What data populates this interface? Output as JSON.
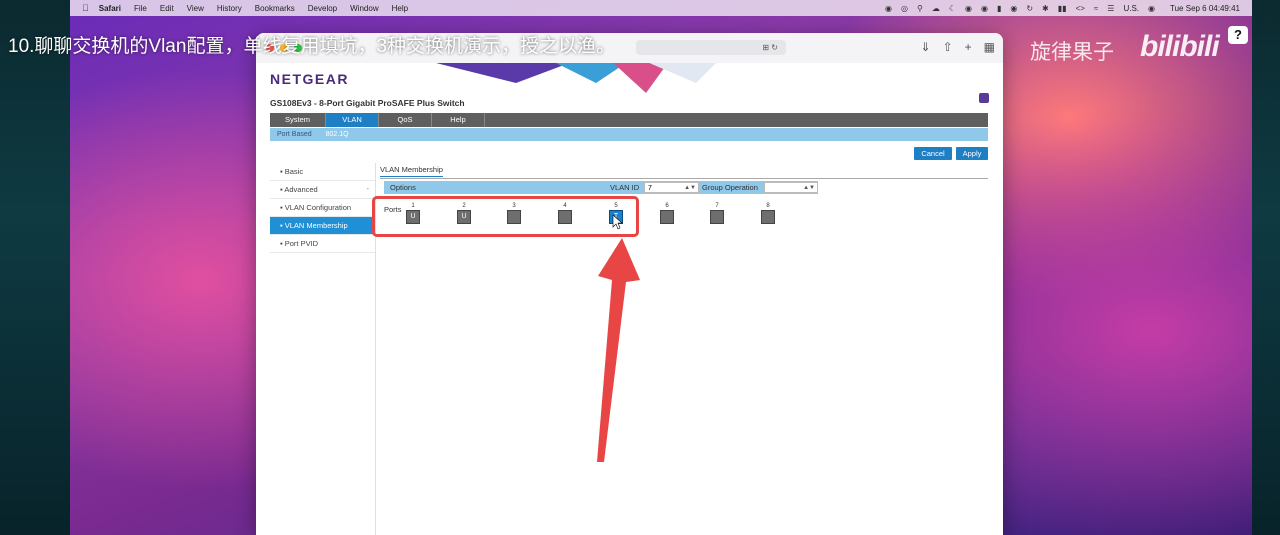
{
  "menubar": {
    "app": "Safari",
    "items": [
      "File",
      "Edit",
      "View",
      "History",
      "Bookmarks",
      "Develop",
      "Window",
      "Help"
    ],
    "input_source": "U.S.",
    "clock": "Tue Sep 6  04:49:41"
  },
  "overlay": {
    "caption": "10.聊聊交换机的Vlan配置，单线复用填坑，3种交换机演示，授之以渔。",
    "brand": "旋律果子",
    "bili": "bilibili",
    "help": "?"
  },
  "browser": {
    "address_icons": "⊞ ↻"
  },
  "netgear": {
    "logo": "NETGEAR",
    "model": "GS108Ev3 - 8-Port Gigabit ProSAFE Plus Switch",
    "tabs": [
      "System",
      "VLAN",
      "QoS",
      "Help"
    ],
    "subtabs": [
      "Port Based",
      "802.1Q"
    ],
    "cancel": "Cancel",
    "apply": "Apply",
    "left_menu": {
      "basic": "Basic",
      "advanced": "Advanced",
      "vlan_config": "VLAN Configuration",
      "vlan_membership": "VLAN Membership",
      "port_pvid": "Port PVID"
    },
    "content": {
      "title": "VLAN Membership",
      "options": "Options",
      "vlan_id_label": "VLAN ID",
      "vlan_id_value": "7",
      "group_op_label": "Group Operation",
      "ports_label": "Ports",
      "ports": [
        {
          "num": "1",
          "state": "U"
        },
        {
          "num": "2",
          "state": "U"
        },
        {
          "num": "3",
          "state": ""
        },
        {
          "num": "4",
          "state": ""
        },
        {
          "num": "5",
          "state": "T"
        },
        {
          "num": "6",
          "state": ""
        },
        {
          "num": "7",
          "state": ""
        },
        {
          "num": "8",
          "state": ""
        }
      ]
    }
  },
  "colors": {
    "netgear_blue": "#1f7fc4",
    "annotation_red": "#e84545"
  }
}
